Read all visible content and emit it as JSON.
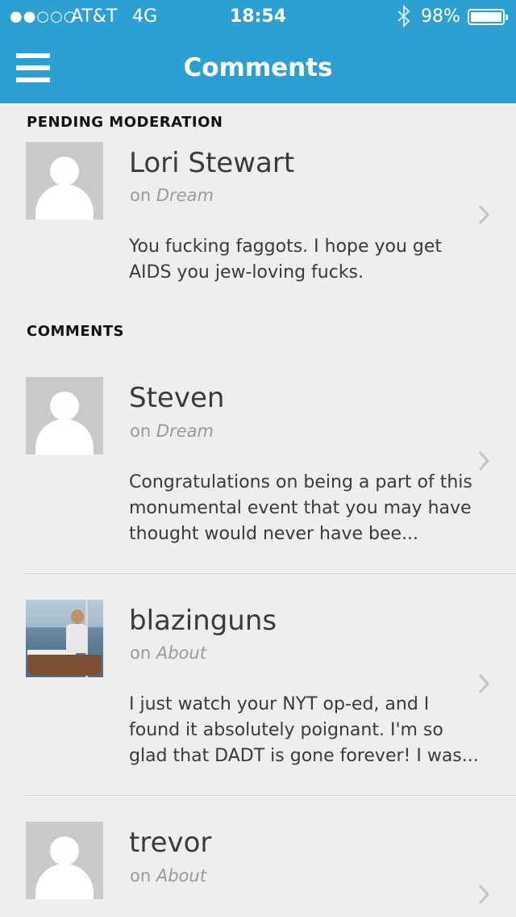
{
  "status_bar": {
    "signal": "●●○○○",
    "carrier": "AT&T",
    "network": "4G",
    "time": "18:54",
    "battery_pct": "98%"
  },
  "nav": {
    "title": "Comments"
  },
  "sections": {
    "pending": "PENDING MODERATION",
    "comments": "COMMENTS"
  },
  "on_label": "on",
  "items": [
    {
      "name": "Lori Stewart",
      "post": "Dream",
      "excerpt": "You fucking faggots.  I hope you get AIDS you jew-loving fucks."
    },
    {
      "name": "Steven",
      "post": "Dream",
      "excerpt": "Congratulations on being a part of this monumental event that you may have thought would never have bee..."
    },
    {
      "name": "blazinguns",
      "post": "About",
      "excerpt": "I just watch your NYT op-ed, and I found it absolutely poignant. I'm so glad that DADT is gone forever! I was..."
    },
    {
      "name": "trevor",
      "post": "About",
      "excerpt": ""
    }
  ],
  "colors": {
    "nav_bg": "#2e9fd1",
    "page_bg": "#eeeeee"
  }
}
